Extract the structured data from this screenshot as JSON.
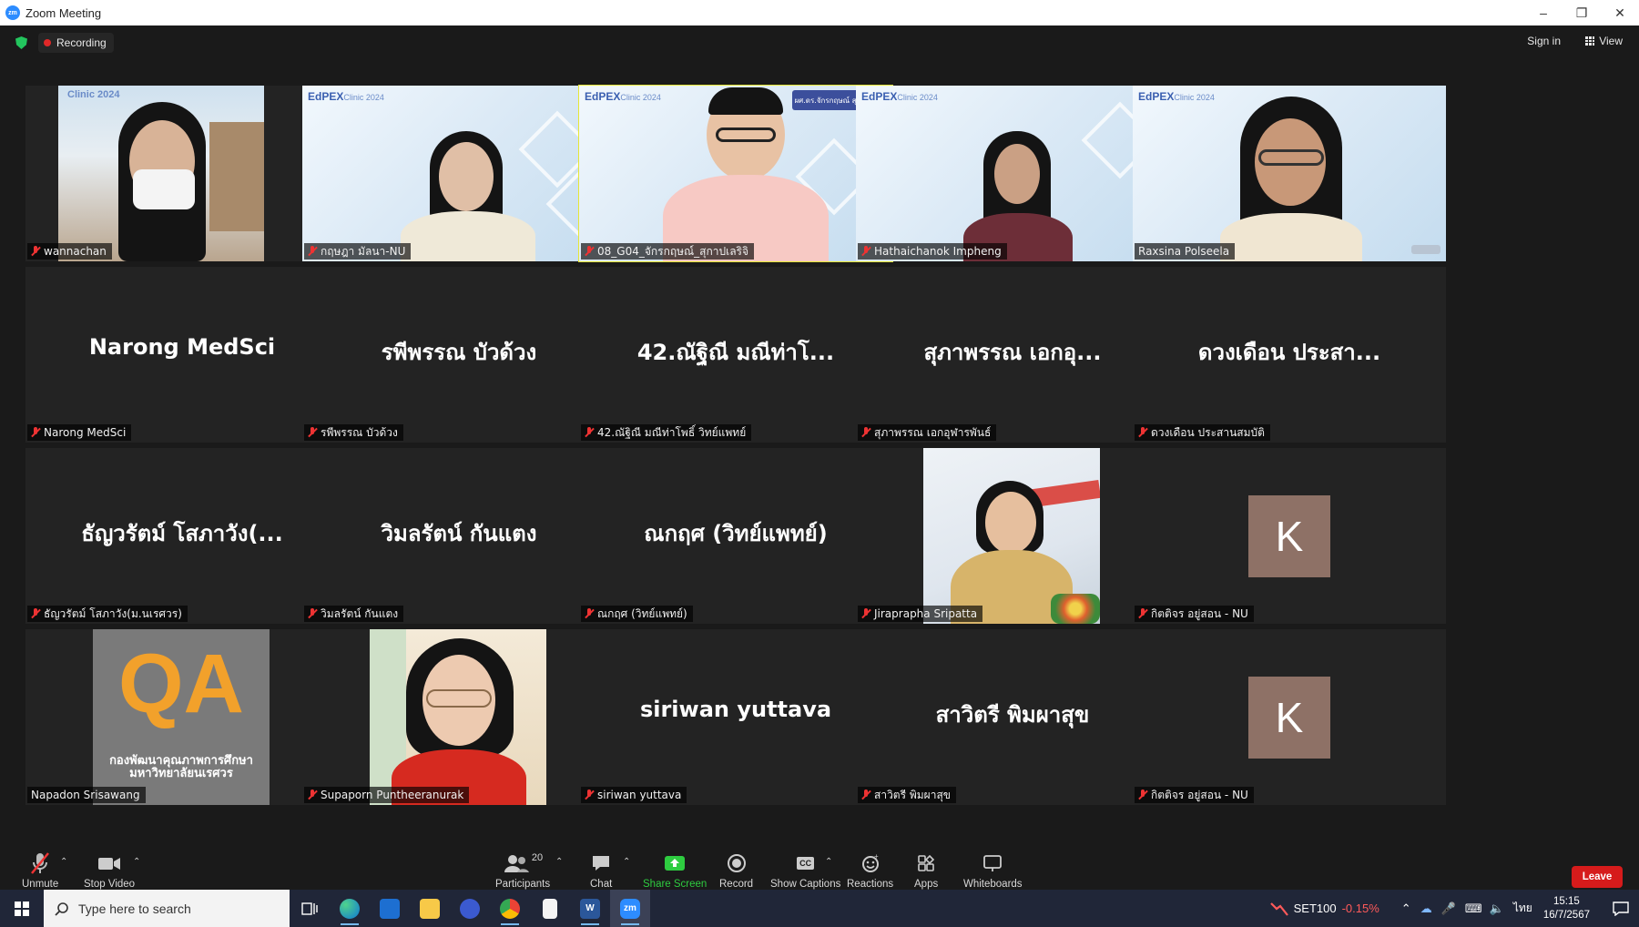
{
  "window": {
    "title": "Zoom Meeting",
    "app_icon": "zm"
  },
  "topbar": {
    "recording_label": "Recording",
    "signin_label": "Sign in",
    "view_label": "View"
  },
  "tiles": [
    {
      "name": "wannachan",
      "big": ""
    },
    {
      "name": "กฤษฎา มัลนา-NU",
      "big": ""
    },
    {
      "name": "08_G04_จักรกฤษณ์_สุกาปเลริจิ",
      "big": ""
    },
    {
      "name": "Hathaichanok Impheng",
      "big": ""
    },
    {
      "name": "Raxsina Polseela",
      "big": ""
    },
    {
      "name": "Narong MedSci",
      "big": "Narong MedSci"
    },
    {
      "name": "รพีพรรณ บัวด้วง",
      "big": "รพีพรรณ บัวด้วง"
    },
    {
      "name": "42.ณัฐิณี มณีท่าโพธิ์ วิทย์แพทย์",
      "big": "42.ณัฐิณี มณีท่าโ..."
    },
    {
      "name": "สุภาพรรณ เอกอุฬารพันธ์",
      "big": "สุภาพรรณ  เอกอุ..."
    },
    {
      "name": "ดวงเดือน ประสานสมบัติ",
      "big": "ดวงเดือน ประสา..."
    },
    {
      "name": "ธัญวรัตม์ โสภาวัง(ม.นเรศวร)",
      "big": "ธัญวรัตม์ โสภาวัง(..."
    },
    {
      "name": "วิมลรัตน์ กันแตง",
      "big": "วิมลรัตน์ กันแตง"
    },
    {
      "name": "ณกฤศ (วิทย์แพทย์)",
      "big": "ณกฤศ (วิทย์แพทย์)"
    },
    {
      "name": "Jiraprapha Sripatta",
      "big": ""
    },
    {
      "name": "กิตติจร อยู่สอน - NU",
      "big": "",
      "avatar": "K"
    },
    {
      "name": "Napadon Srisawang",
      "big": ""
    },
    {
      "name": "Supaporn Puntheeranurak",
      "big": ""
    },
    {
      "name": "siriwan yuttava",
      "big": "siriwan yuttava"
    },
    {
      "name": "สาวิตรี  พิมผาสุข",
      "big": "สาวิตรี  พิมผาสุข"
    },
    {
      "name": "กิตติจร อยู่สอน - NU",
      "big": "",
      "avatar": "K"
    }
  ],
  "banners": {
    "edpex": "EdPEX",
    "clinic": "Clinic 2024",
    "speaker_banner": "ผศ.ดร.จักรกฤษณ์ สุกาปเลริจิ"
  },
  "qa_logo": {
    "letters": "QA",
    "line1": "กองพัฒนาคุณภาพการศึกษา",
    "line2": "มหาวิทยาลัยนเรศวร"
  },
  "toolbar": {
    "unmute": "Unmute",
    "stop_video": "Stop Video",
    "participants": "Participants",
    "participants_count": "20",
    "chat": "Chat",
    "share_screen": "Share Screen",
    "record": "Record",
    "show_captions": "Show Captions",
    "cc": "CC",
    "reactions": "Reactions",
    "apps": "Apps",
    "whiteboards": "Whiteboards",
    "leave": "Leave"
  },
  "taskbar": {
    "search_placeholder": "Type here to search",
    "ticker_name": "SET100",
    "ticker_change": "-0.15%",
    "language": "ไทย",
    "time": "15:15",
    "date": "16/7/2567",
    "zoom_label": "zm"
  },
  "colors": {
    "accent_green": "#2ecc40",
    "leave_red": "#d61b1b",
    "active_speaker": "#e6e636",
    "ticker_red": "#ff5a5a"
  }
}
